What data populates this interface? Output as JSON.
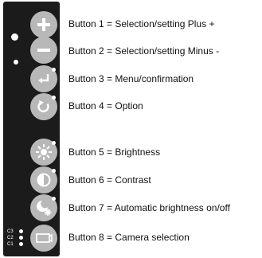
{
  "colors": {
    "panel": "#1b1b1b",
    "button": "#b8b8b8",
    "led": "#ffffff",
    "text": "#111111"
  },
  "camera_indicators": [
    "C3",
    "C2",
    "C1"
  ],
  "buttons": [
    {
      "icon": "plus-icon",
      "description": "Button 1 = Selection/setting Plus +"
    },
    {
      "icon": "minus-icon",
      "description": "Button 2 = Selection/setting Minus -"
    },
    {
      "icon": "enter-icon",
      "description": "Button 3 = Menu/confirmation"
    },
    {
      "icon": "option-circular-arrow-icon",
      "description": "Button 4 = Option"
    },
    {
      "icon": "brightness-icon",
      "description": "Button 5 = Brightness"
    },
    {
      "icon": "contrast-icon",
      "description": "Button 6 = Contrast"
    },
    {
      "icon": "auto-brightness-icon",
      "description": "Button 7 = Automatic brightness on/off"
    },
    {
      "icon": "camera-icon",
      "description": "Button 8 = Camera selection"
    }
  ]
}
